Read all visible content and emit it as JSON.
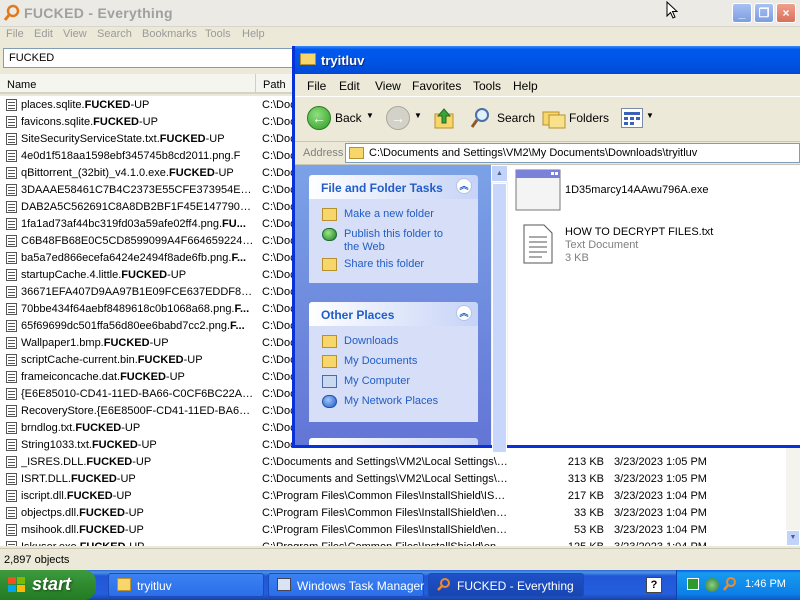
{
  "everything": {
    "title": "FUCKED - Everything",
    "menu": [
      "File",
      "Edit",
      "View",
      "Search",
      "Bookmarks",
      "Tools",
      "Help"
    ],
    "search_value": "FUCKED",
    "columns": [
      "Name",
      "Path"
    ],
    "rows": [
      {
        "pre": "places.sqlite.",
        "bold": "FUCKED",
        "post": "-UP",
        "path": "C:\\Doc",
        "size": "",
        "date": ""
      },
      {
        "pre": "favicons.sqlite.",
        "bold": "FUCKED",
        "post": "-UP",
        "path": "C:\\Doc",
        "size": "",
        "date": ""
      },
      {
        "pre": "SiteSecurityServiceState.txt.",
        "bold": "FUCKED",
        "post": "-UP",
        "path": "C:\\Doc",
        "size": "",
        "date": ""
      },
      {
        "pre": "4e0d1f518aa1598ebf345745b8cd2011.png.F",
        "bold": "",
        "post": "",
        "path": "C:\\Doc",
        "size": "",
        "date": ""
      },
      {
        "pre": "qBittorrent_(32bit)_v4.1.0.exe.",
        "bold": "FUCKED",
        "post": "-UP",
        "path": "C:\\Doc",
        "size": "",
        "date": ""
      },
      {
        "pre": "3DAAAE58461C7B4C2373E55CFE373954E96...",
        "bold": "",
        "post": "",
        "path": "C:\\Doc",
        "size": "",
        "date": ""
      },
      {
        "pre": "DAB2A5C562691C8A8DB2BF1F45E1477900B...",
        "bold": "",
        "post": "",
        "path": "C:\\Doc",
        "size": "",
        "date": ""
      },
      {
        "pre": "1fa1ad73af44bc319fd03a59afe02ff4.png.",
        "bold": "FU...",
        "post": "",
        "path": "C:\\Doc",
        "size": "",
        "date": ""
      },
      {
        "pre": "C6B48FB68E0C5CD8599099A4F6646592242...",
        "bold": "",
        "post": "",
        "path": "C:\\Doc",
        "size": "",
        "date": ""
      },
      {
        "pre": "ba5a7ed866ecefa6424e2494f8ade6fb.png.",
        "bold": "F...",
        "post": "",
        "path": "C:\\Doc",
        "size": "",
        "date": ""
      },
      {
        "pre": "startupCache.4.little.",
        "bold": "FUCKED",
        "post": "-UP",
        "path": "C:\\Doc",
        "size": "",
        "date": ""
      },
      {
        "pre": "36671EFA407D9AA97B1E09FCE637EDDF8D5...",
        "bold": "",
        "post": "",
        "path": "C:\\Doc",
        "size": "",
        "date": ""
      },
      {
        "pre": "70bbe434f64aebf8489618c0b1068a68.png.",
        "bold": "F...",
        "post": "",
        "path": "C:\\Doc",
        "size": "",
        "date": ""
      },
      {
        "pre": "65f69699dc501ffa56d80ee6babd7cc2.png.",
        "bold": "F...",
        "post": "",
        "path": "C:\\Doc",
        "size": "",
        "date": ""
      },
      {
        "pre": "Wallpaper1.bmp.",
        "bold": "FUCKED",
        "post": "-UP",
        "path": "C:\\Doc",
        "size": "",
        "date": ""
      },
      {
        "pre": "scriptCache-current.bin.",
        "bold": "FUCKED",
        "post": "-UP",
        "path": "C:\\Doc",
        "size": "",
        "date": ""
      },
      {
        "pre": "frameiconcache.dat.",
        "bold": "FUCKED",
        "post": "-UP",
        "path": "C:\\Doc",
        "size": "",
        "date": ""
      },
      {
        "pre": "{E6E85010-CD41-11ED-BA66-C0CF6BC22A1...",
        "bold": "",
        "post": "",
        "path": "C:\\Doc",
        "size": "",
        "date": ""
      },
      {
        "pre": "RecoveryStore.{E6E8500F-CD41-11ED-BA66...",
        "bold": "",
        "post": "",
        "path": "C:\\Doc",
        "size": "",
        "date": ""
      },
      {
        "pre": "brndlog.txt.",
        "bold": "FUCKED",
        "post": "-UP",
        "path": "C:\\Doc",
        "size": "",
        "date": ""
      },
      {
        "pre": "String1033.txt.",
        "bold": "FUCKED",
        "post": "-UP",
        "path": "C:\\Doc",
        "size": "",
        "date": ""
      },
      {
        "pre": "_ISRES.DLL.",
        "bold": "FUCKED",
        "post": "-UP",
        "path": "C:\\Documents and Settings\\VM2\\Local Settings\\T...",
        "size": "213 KB",
        "date": "3/23/2023 1:05 PM"
      },
      {
        "pre": "ISRT.DLL.",
        "bold": "FUCKED",
        "post": "-UP",
        "path": "C:\\Documents and Settings\\VM2\\Local Settings\\T...",
        "size": "313 KB",
        "date": "3/23/2023 1:05 PM"
      },
      {
        "pre": "iscript.dll.",
        "bold": "FUCKED",
        "post": "-UP",
        "path": "C:\\Program Files\\Common Files\\InstallShield\\IScript",
        "size": "217 KB",
        "date": "3/23/2023 1:04 PM"
      },
      {
        "pre": "objectps.dll.",
        "bold": "FUCKED",
        "post": "-UP",
        "path": "C:\\Program Files\\Common Files\\InstallShield\\engi...",
        "size": "33 KB",
        "date": "3/23/2023 1:04 PM"
      },
      {
        "pre": "msihook.dll.",
        "bold": "FUCKED",
        "post": "-UP",
        "path": "C:\\Program Files\\Common Files\\InstallShield\\engi...",
        "size": "53 KB",
        "date": "3/23/2023 1:04 PM"
      },
      {
        "pre": "Iskuser.exe.",
        "bold": "FUCKED",
        "post": "-UP",
        "path": "C:\\Program Files\\Common Files\\InstallShield\\engi...",
        "size": "125 KB",
        "date": "3/23/2023 1:04 PM"
      }
    ],
    "status": "2,897 objects"
  },
  "explorer": {
    "title": "tryitluv",
    "menu": [
      "File",
      "Edit",
      "View",
      "Favorites",
      "Tools",
      "Help"
    ],
    "toolbar": {
      "back": "Back",
      "search": "Search",
      "folders": "Folders"
    },
    "address_label": "Address",
    "address": "C:\\Documents and Settings\\VM2\\My Documents\\Downloads\\tryitluv",
    "tasks_title": "File and Folder Tasks",
    "tasks": [
      "Make a new folder",
      "Publish this folder to the Web",
      "Share this folder"
    ],
    "places_title": "Other Places",
    "places": [
      "Downloads",
      "My Documents",
      "My Computer",
      "My Network Places"
    ],
    "files": [
      {
        "name": "1D35marcy14AAwu796A.exe",
        "type": "",
        "size": ""
      },
      {
        "name": "HOW TO DECRYPT FILES.txt",
        "type": "Text Document",
        "size": "3 KB"
      }
    ]
  },
  "taskbar": {
    "start": "start",
    "tasks": [
      "tryitluv",
      "Windows Task Manager",
      "FUCKED - Everything"
    ],
    "clock": "1:46 PM"
  }
}
